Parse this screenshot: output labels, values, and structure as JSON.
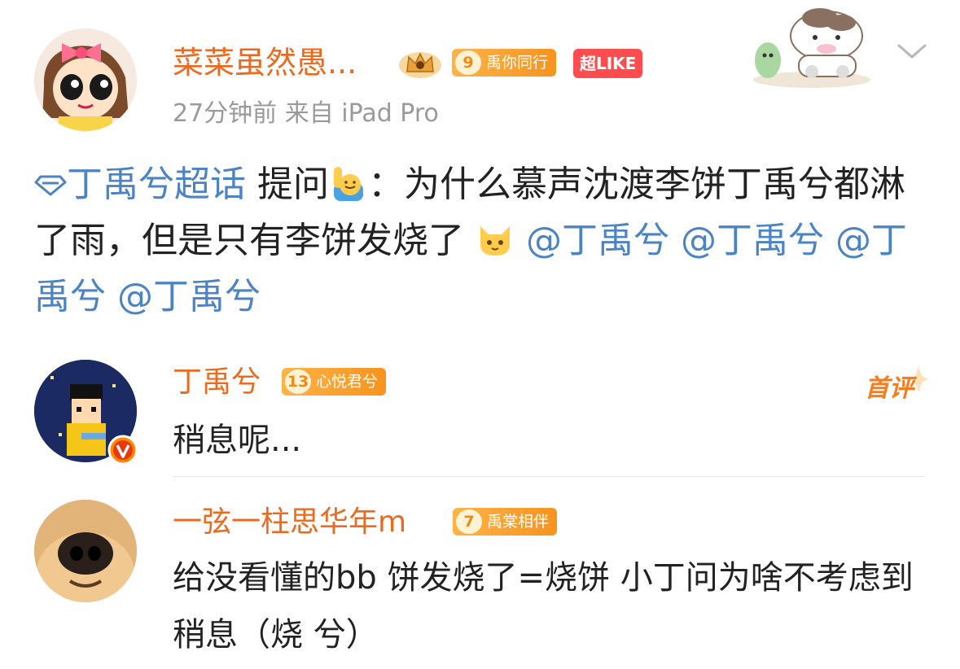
{
  "post": {
    "author": "菜菜虽然愚...",
    "fan_badge": {
      "level": "9",
      "title": "禹你同行"
    },
    "super_like": "超LIKE",
    "meta": "27分钟前  来自 iPad Pro",
    "body": {
      "topic": "丁禹兮超话",
      "text_1": " 提问",
      "text_2": "：为什么慕声沈渡李饼丁禹兮都淋了雨，但是只有李饼发烧了",
      "mentions": [
        "@丁禹兮",
        "@丁禹兮",
        "@丁禹兮",
        "@丁禹兮"
      ]
    }
  },
  "comments": [
    {
      "author": "丁禹兮",
      "fan_badge": {
        "level": "13",
        "title": "心悦君兮"
      },
      "tag": "首评",
      "text": "稍息呢..."
    },
    {
      "author": "一弦一柱思华年m",
      "fan_badge": {
        "level": "7",
        "title": "禹棠相伴"
      },
      "text": "给没看懂的bb 饼发烧了=烧饼 小丁问为啥不考虑到稍息（烧 兮）"
    }
  ],
  "colors": {
    "username": "#ec6a1e",
    "link": "#4c83c3",
    "meta": "#9a9a9a",
    "super_like_bg": "#ff4d4f"
  },
  "icons": [
    "crown-badge-icon",
    "chevron-down-icon",
    "diamond-topic-icon",
    "raising-hand-emoji",
    "cat-emoji",
    "verified-v-icon"
  ]
}
